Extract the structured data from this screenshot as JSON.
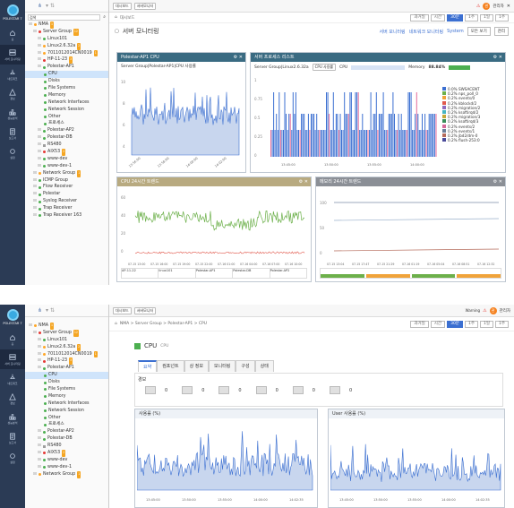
{
  "brand": {
    "name": "POLESTAR 7"
  },
  "nav": [
    {
      "icon": "home-icon",
      "label": "홈"
    },
    {
      "icon": "server-icon",
      "label": "서버 모니터링"
    },
    {
      "icon": "network-icon",
      "label": "네트워크"
    },
    {
      "icon": "alert-icon",
      "label": "경보"
    },
    {
      "icon": "chart-icon",
      "label": "성능분석"
    },
    {
      "icon": "report-icon",
      "label": "보고서"
    },
    {
      "icon": "settings-icon",
      "label": "설정"
    }
  ],
  "tree": {
    "search_placeholder": "검색",
    "items": [
      {
        "label": "NMA",
        "badge": "1",
        "dot": "o",
        "lvl": 0
      },
      {
        "label": "Server Group",
        "badge": "12",
        "dot": "r",
        "lvl": 1
      },
      {
        "label": "Linux101",
        "dot": "g",
        "lvl": 2
      },
      {
        "label": "Linux2.6.32a",
        "badge": "2",
        "dot": "o",
        "lvl": 2
      },
      {
        "label": "7011012014CN0019",
        "badge": "1",
        "dot": "o",
        "lvl": 2
      },
      {
        "label": "HP-11-23",
        "badge": "3",
        "dot": "r",
        "lvl": 2
      },
      {
        "label": "Polestar-AP1",
        "dot": "g",
        "lvl": 2
      },
      {
        "label": "CPU",
        "dot": "g",
        "lvl": 3,
        "sel": true
      },
      {
        "label": "Disks",
        "dot": "g",
        "lvl": 3
      },
      {
        "label": "File Systems",
        "dot": "g",
        "lvl": 3
      },
      {
        "label": "Memory",
        "dot": "g",
        "lvl": 3
      },
      {
        "label": "Network Interfaces",
        "dot": "g",
        "lvl": 3
      },
      {
        "label": "Network Session",
        "dot": "g",
        "lvl": 3
      },
      {
        "label": "Other",
        "dot": "g",
        "lvl": 3
      },
      {
        "label": "프로세스",
        "dot": "g",
        "lvl": 3
      },
      {
        "label": "Polestar-AP2",
        "dot": "g",
        "lvl": 2
      },
      {
        "label": "Polestar-DB",
        "dot": "g",
        "lvl": 2
      },
      {
        "label": "RS480",
        "dot": "b",
        "lvl": 2
      },
      {
        "label": "AIX53",
        "badge": "2",
        "dot": "r",
        "lvl": 2
      },
      {
        "label": "www-dev",
        "dot": "g",
        "lvl": 2
      },
      {
        "label": "www-dev-1",
        "dot": "g",
        "lvl": 2
      },
      {
        "label": "Network Group",
        "badge": "1",
        "dot": "o",
        "lvl": 1
      },
      {
        "label": "ICMP Group",
        "dot": "g",
        "lvl": 1
      },
      {
        "label": "Flow Receiver",
        "dot": "g",
        "lvl": 1
      },
      {
        "label": "Polestar",
        "dot": "g",
        "lvl": 1
      },
      {
        "label": "Syslog Receiver",
        "dot": "g",
        "lvl": 1
      },
      {
        "label": "Trap Receiver",
        "dot": "g",
        "lvl": 1
      },
      {
        "label": "Trap Receiver 163",
        "dot": "g",
        "lvl": 1
      }
    ]
  },
  "topbar": {
    "tab1": "대시보드",
    "tab2": "서버모니터",
    "ranges": [
      "과거일",
      "시간",
      "30분",
      "1주",
      "1일",
      "1주"
    ],
    "user": "관리자",
    "status": "Warning"
  },
  "screen1": {
    "breadcrumb": "대시보드",
    "title": "서버 모니터링",
    "links": [
      "서버 모니터링",
      "네트워크 모니터링",
      "System"
    ],
    "buttons": [
      "모든 보기",
      "관리"
    ],
    "w1": {
      "title": "Polestar-AP1 CPU",
      "sub": "Server Group|Polestar-AP1|CPU 사용률"
    },
    "w2": {
      "title": "서버 프로세스 리스트",
      "sub": "Server Group|Linux2.6.32a",
      "cpu": "CPU",
      "mem": "Memory",
      "mem_val": "88.84%",
      "legend": [
        "0.0% SWSACENT",
        "0.2% nps_poll_0",
        "0.2% events/0",
        "0.2% kblockd/2",
        "0.2% migration/2",
        "0.2% ksoftirqd/2",
        "0.2% migration/3",
        "0.2% ksoftirqd/3",
        "0.2% events/2",
        "0.2% events/1",
        "0.2% jbd2/dm-0",
        "0.2% flush-253:0"
      ],
      "yt": [
        "1",
        "0.75",
        "0.5",
        "0.25",
        "0"
      ],
      "xt": [
        "13:45:00",
        "13:50:00",
        "13:55:00",
        "14:00:00"
      ]
    },
    "w3": {
      "title": "CPU 24시간 트렌드",
      "xt": [
        "07-15 13:00",
        "07-15 16:00",
        "07-15 19:00",
        "07-15 22:00",
        "07-16 01:00",
        "07-16 04:00",
        "07-16 07:00",
        "07-16 10:00"
      ],
      "yt": [
        "60",
        "40",
        "20",
        "0"
      ]
    },
    "w4": {
      "title": "메모리 24시간 트렌드",
      "xt": [
        "07-15 13:04",
        "07-15 17:47",
        "07-15 21:29",
        "07-16 01:19",
        "07-16 05:04",
        "07-16 08:51",
        "07-16 12:32"
      ],
      "yt": [
        "100",
        "50",
        "0"
      ]
    }
  },
  "screen2": {
    "breadcrumb": "NMA > Server Group > Polestar-AP1 > CPU",
    "title": "CPU",
    "title_en": "CPU",
    "tabs": [
      "요약",
      "컴포넌트",
      "상 정보",
      "모니터링",
      "구성",
      "상태"
    ],
    "stat_label": "경보",
    "stats": [
      "0",
      "0",
      "0",
      "0",
      "0",
      "0"
    ],
    "c1": {
      "title": "사용률 (%)",
      "xt": [
        "13:45:00",
        "13:50:00",
        "13:55:00",
        "14:00:00",
        "14:02:35"
      ]
    },
    "c2": {
      "title": "User 사용률 (%)",
      "xt": [
        "13:45:00",
        "13:50:00",
        "13:55:00",
        "14:00:00",
        "14:02:35"
      ]
    }
  }
}
